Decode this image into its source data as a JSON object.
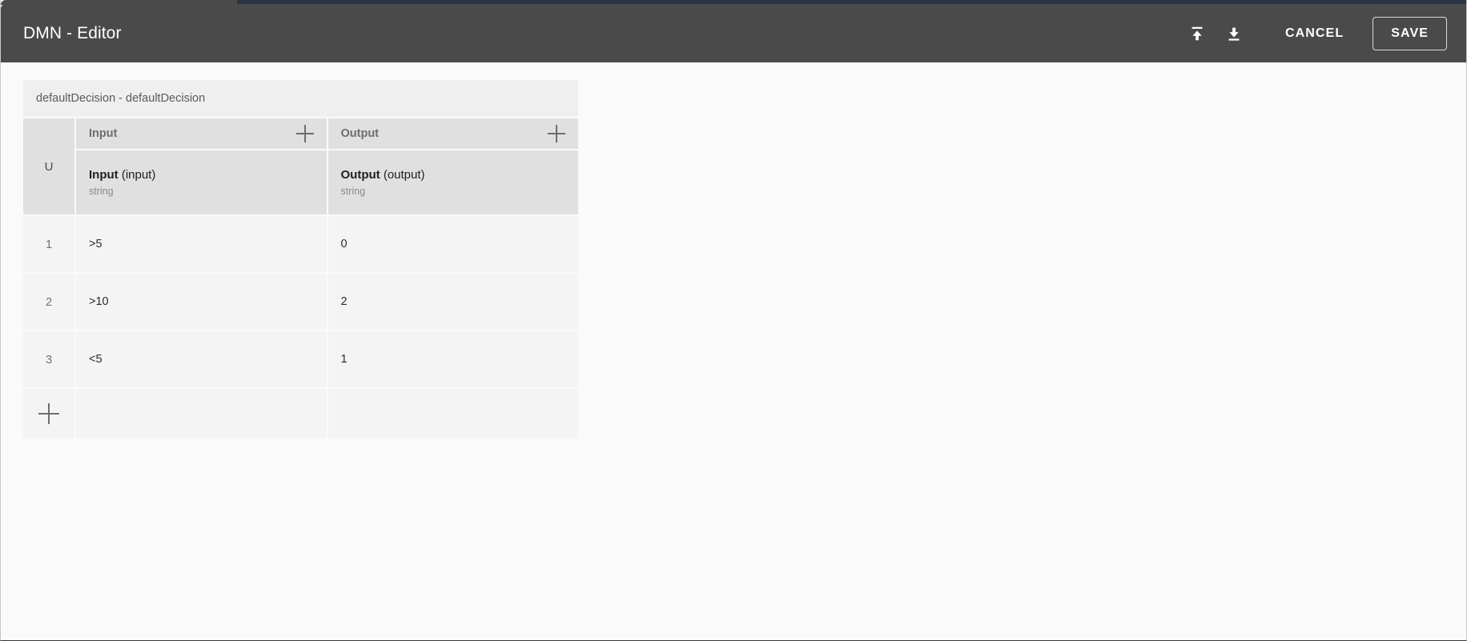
{
  "window": {
    "title": "DMN - Editor"
  },
  "toolbar": {
    "upload_icon": "upload-icon",
    "download_icon": "download-icon",
    "cancel_label": "CANCEL",
    "save_label": "SAVE"
  },
  "decision_table": {
    "title": "defaultDecision - defaultDecision",
    "hit_policy": "U",
    "groups": [
      {
        "label": "Input",
        "add_icon": "plus-icon"
      },
      {
        "label": "Output",
        "add_icon": "plus-icon"
      }
    ],
    "columns": [
      {
        "name": "Input",
        "expression": "(input)",
        "type": "string"
      },
      {
        "name": "Output",
        "expression": "(output)",
        "type": "string"
      }
    ],
    "rows": [
      {
        "number": "1",
        "input": ">5",
        "output": "0"
      },
      {
        "number": "2",
        "input": ">10",
        "output": "2"
      },
      {
        "number": "3",
        "input": "<5",
        "output": "1"
      }
    ],
    "add_row_icon": "plus-icon"
  },
  "colors": {
    "appbar_bg": "#4a4a4a",
    "surface_bg": "#fafafa",
    "title_bar_bg": "#efefef",
    "header_cell_bg": "#e0e0e0",
    "rule_cell_bg": "#f4f4f4",
    "accent_text": "#ffffff"
  }
}
